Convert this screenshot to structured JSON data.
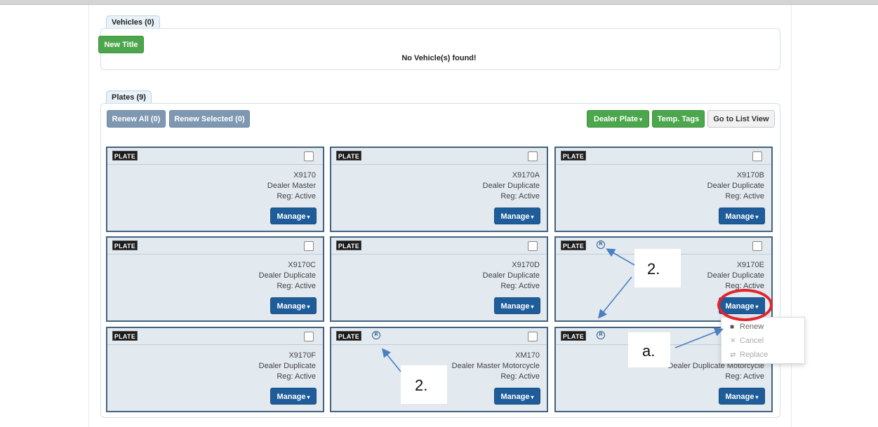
{
  "vehicles": {
    "tab_label": "Vehicles (0)",
    "new_title_label": "New Title",
    "empty_message": "No Vehicle(s) found!"
  },
  "plates": {
    "tab_label": "Plates (9)",
    "renew_all_label": "Renew All (0)",
    "renew_selected_label": "Renew Selected (0)",
    "dealer_plate_label": "Dealer Plate",
    "temp_tags_label": "Temp. Tags",
    "list_view_label": "Go to List View",
    "manage_label": "Manage",
    "logo_text": "PLATE",
    "cards": [
      {
        "plate": "X9170",
        "type": "Dealer Master",
        "reg": "Reg: Active",
        "registered_icon": false
      },
      {
        "plate": "X9170A",
        "type": "Dealer Duplicate",
        "reg": "Reg: Active",
        "registered_icon": false
      },
      {
        "plate": "X9170B",
        "type": "Dealer Duplicate",
        "reg": "Reg: Active",
        "registered_icon": false
      },
      {
        "plate": "X9170C",
        "type": "Dealer Duplicate",
        "reg": "Reg: Active",
        "registered_icon": false
      },
      {
        "plate": "X9170D",
        "type": "Dealer Duplicate",
        "reg": "Reg: Active",
        "registered_icon": false
      },
      {
        "plate": "X9170E",
        "type": "Dealer Duplicate",
        "reg": "Reg: Active",
        "registered_icon": true
      },
      {
        "plate": "X9170F",
        "type": "Dealer Duplicate",
        "reg": "Reg: Active",
        "registered_icon": false
      },
      {
        "plate": "XM170",
        "type": "Dealer Master Motorcycle",
        "reg": "Reg: Active",
        "registered_icon": true
      },
      {
        "plate": "",
        "type": "Dealer Duplicate Motorcycle",
        "reg": "Reg: Active",
        "registered_icon": true
      }
    ]
  },
  "manage_menu": {
    "items": [
      {
        "label": "Renew",
        "icon": "book-icon",
        "enabled": true
      },
      {
        "label": "Cancel",
        "icon": "x-icon",
        "enabled": false
      },
      {
        "label": "Replace",
        "icon": "swap-icon",
        "enabled": false
      }
    ]
  },
  "annotations": {
    "callout_1": "2.",
    "callout_2": "2.",
    "callout_3": "a.",
    "arrow_color": "#4a7fc1",
    "highlight_color": "#e2242c"
  }
}
